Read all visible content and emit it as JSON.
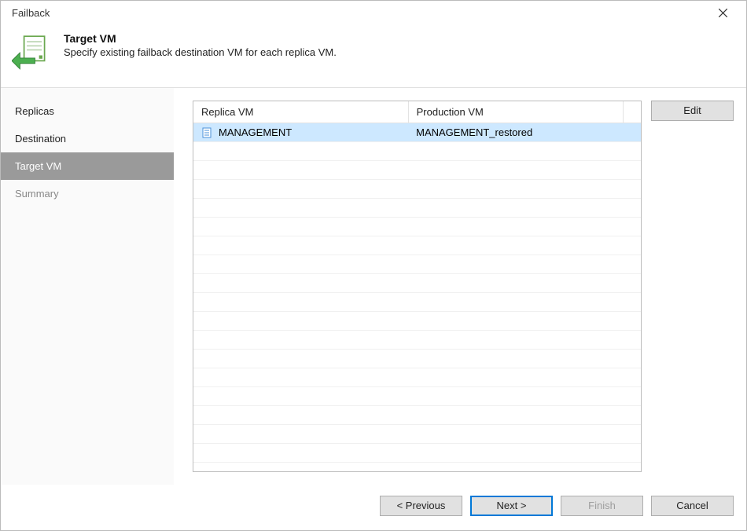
{
  "window": {
    "title": "Failback"
  },
  "header": {
    "title": "Target VM",
    "subtitle": "Specify existing failback destination VM for each replica VM."
  },
  "sidebar": {
    "items": [
      {
        "label": "Replicas",
        "active": false,
        "disabled": false
      },
      {
        "label": "Destination",
        "active": false,
        "disabled": false
      },
      {
        "label": "Target VM",
        "active": true,
        "disabled": false
      },
      {
        "label": "Summary",
        "active": false,
        "disabled": true
      }
    ]
  },
  "table": {
    "columns": {
      "replica": "Replica VM",
      "production": "Production VM"
    },
    "rows": [
      {
        "replica": "MANAGEMENT",
        "production": "MANAGEMENT_restored",
        "selected": true
      }
    ]
  },
  "buttons": {
    "edit": "Edit",
    "previous": "< Previous",
    "next": "Next >",
    "finish": "Finish",
    "cancel": "Cancel"
  }
}
